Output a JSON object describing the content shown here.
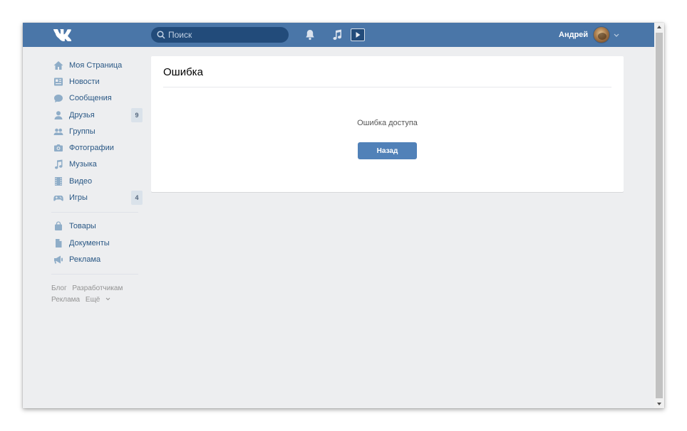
{
  "header": {
    "logo": "vk-logo",
    "search": {
      "placeholder": "Поиск"
    },
    "user_name": "Андрей",
    "colors": {
      "header_bg": "#4a76a8",
      "search_bg": "#224b7a"
    }
  },
  "sidebar": {
    "items": [
      {
        "label": "Моя Страница",
        "icon": "home-icon"
      },
      {
        "label": "Новости",
        "icon": "news-icon"
      },
      {
        "label": "Сообщения",
        "icon": "messages-icon"
      },
      {
        "label": "Друзья",
        "icon": "friends-icon",
        "badge": "9"
      },
      {
        "label": "Группы",
        "icon": "groups-icon"
      },
      {
        "label": "Фотографии",
        "icon": "camera-icon"
      },
      {
        "label": "Музыка",
        "icon": "music-icon"
      },
      {
        "label": "Видео",
        "icon": "film-icon"
      },
      {
        "label": "Игры",
        "icon": "gamepad-icon",
        "badge": "4"
      }
    ],
    "secondary_items": [
      {
        "label": "Товары",
        "icon": "shopping-bag-icon"
      },
      {
        "label": "Документы",
        "icon": "document-icon"
      },
      {
        "label": "Реклама",
        "icon": "megaphone-icon"
      }
    ],
    "footer": {
      "blog": "Блог",
      "developers": "Разработчикам",
      "ads": "Реклама",
      "more": "Ещё"
    }
  },
  "main": {
    "title": "Ошибка",
    "message": "Ошибка доступа",
    "back_button": "Назад",
    "colors": {
      "button_bg": "#5181b8",
      "page_bg": "#edeef0"
    }
  }
}
